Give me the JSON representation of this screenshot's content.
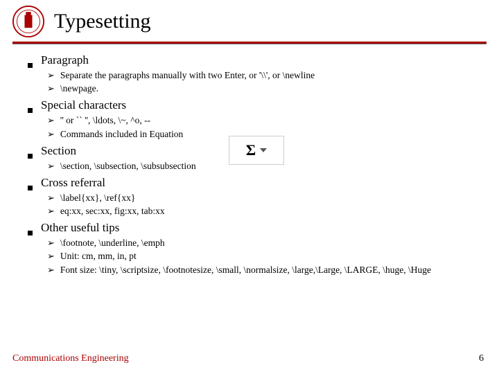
{
  "header": {
    "title": "Typesetting"
  },
  "sections": {
    "s0": {
      "label": "Paragraph",
      "i0": "Separate the paragraphs manually with two Enter, or '\\\\', or \\newline",
      "i1": "\\newpage."
    },
    "s1": {
      "label": "Special characters",
      "i0": "'' or `` '', \\ldots, \\~, ^o, --",
      "i1": "Commands included in Equation"
    },
    "s2": {
      "label": "Section",
      "i0": "\\section, \\subsection, \\subsubsection"
    },
    "s3": {
      "label": "Cross referral",
      "i0": "\\label{xx}, \\ref{xx}",
      "i1": "eq:xx, sec:xx, fig:xx, tab:xx"
    },
    "s4": {
      "label": "Other useful tips",
      "i0": "\\footnote, \\underline, \\emph",
      "i1": "Unit: cm, mm, in, pt",
      "i2": "Font size: \\tiny, \\scriptsize, \\footnotesize, \\small, \\normalsize, \\large,\\Large, \\LARGE, \\huge, \\Huge"
    }
  },
  "sigma": {
    "glyph": "Σ"
  },
  "footer": {
    "left": "Communications Engineering",
    "page": "6"
  }
}
